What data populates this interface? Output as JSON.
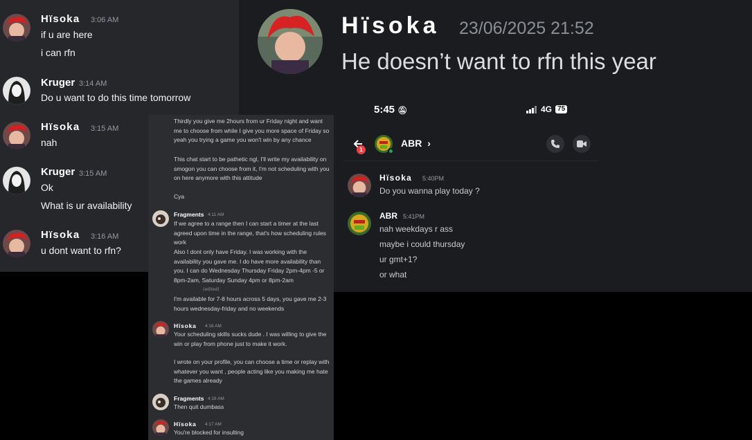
{
  "panel1": {
    "messages": [
      {
        "author": "Hïsoka",
        "time": "3:06 AM",
        "lines": [
          "if u are here",
          "i can rfn"
        ]
      },
      {
        "author": "Kruger",
        "time": "3:14 AM",
        "lines": [
          "Do u want to do this time tomorrow"
        ]
      },
      {
        "author": "Hïsoka",
        "time": "3:15 AM",
        "lines": [
          "nah"
        ]
      },
      {
        "author": "Kruger",
        "time": "3:15 AM",
        "lines": [
          "Ok",
          "What is ur availability"
        ]
      },
      {
        "author": "Hïsoka",
        "time": "3:16 AM",
        "lines": [
          "u dont want to rfn?"
        ]
      }
    ]
  },
  "panel2": {
    "header": {
      "author": "Hïsoka",
      "timestamp": "23/06/2025 21:52",
      "message": "He doesn’t want to rfn this year"
    },
    "phone": {
      "time": "5:45",
      "network": "4G",
      "battery": "75",
      "contact": "ABR",
      "back_badge": "1",
      "icons": {
        "back": "back-arrow-icon",
        "call": "phone-icon",
        "video": "video-icon",
        "mute": "bell-muted-icon"
      }
    },
    "messages": [
      {
        "author": "Hïsoka",
        "time": "5:40PM",
        "lines": [
          "Do you wanna play today ?"
        ]
      },
      {
        "author": "ABR",
        "time": "5:41PM",
        "lines": [
          "nah weekdays r ass",
          "maybe i could thursday",
          "ur gmt+1?",
          "or what"
        ]
      }
    ]
  },
  "panel3": {
    "top_lines": [
      "Thirdly you give me 2hours from ur Friday night and want me to choose from while I give you more space of Friday so yeah you trying a game you won't win by any chance",
      "This chat start to be pathetic ngl, I'll write my availability on smogon you can choose from it, I'm not scheduling with you on here anymore with this attitude",
      "Cya"
    ],
    "messages": [
      {
        "author": "Fragments",
        "time": "4:11 AM",
        "paragraphs": [
          "If we agree to a range then I can start a timer at the last agreed upon time in the range, that's how scheduling rules work",
          "Also I dont only have Friday. I was working with the availability you gave me. I do have more availability than you. I can do Wednesday Thursday Friday 2pm-4pm -5 or 8pm-2am, Saturday Sunday 4pm or 8pm-2am",
          "I'm available for 7-8 hours across 5 days, you gave me 2-3 hours wednesday-friday and no weekends"
        ],
        "edited": "(edited)"
      },
      {
        "author": "Hïsoka",
        "time": "4:16 AM",
        "paragraphs": [
          "Your scheduling skills sucks dude . I was willing to give the win or play from phone just to make it work.",
          "I wrote on your profile, you can choose a time or replay with whatever you want , people acting like you making me hate the games already"
        ]
      },
      {
        "author": "Fragments",
        "time": "4:16 AM",
        "paragraphs": [
          "Then quit dumbass"
        ]
      },
      {
        "author": "Hïsoka",
        "time": "4:17 AM",
        "paragraphs": [
          "You're blocked for insulting"
        ]
      }
    ]
  }
}
